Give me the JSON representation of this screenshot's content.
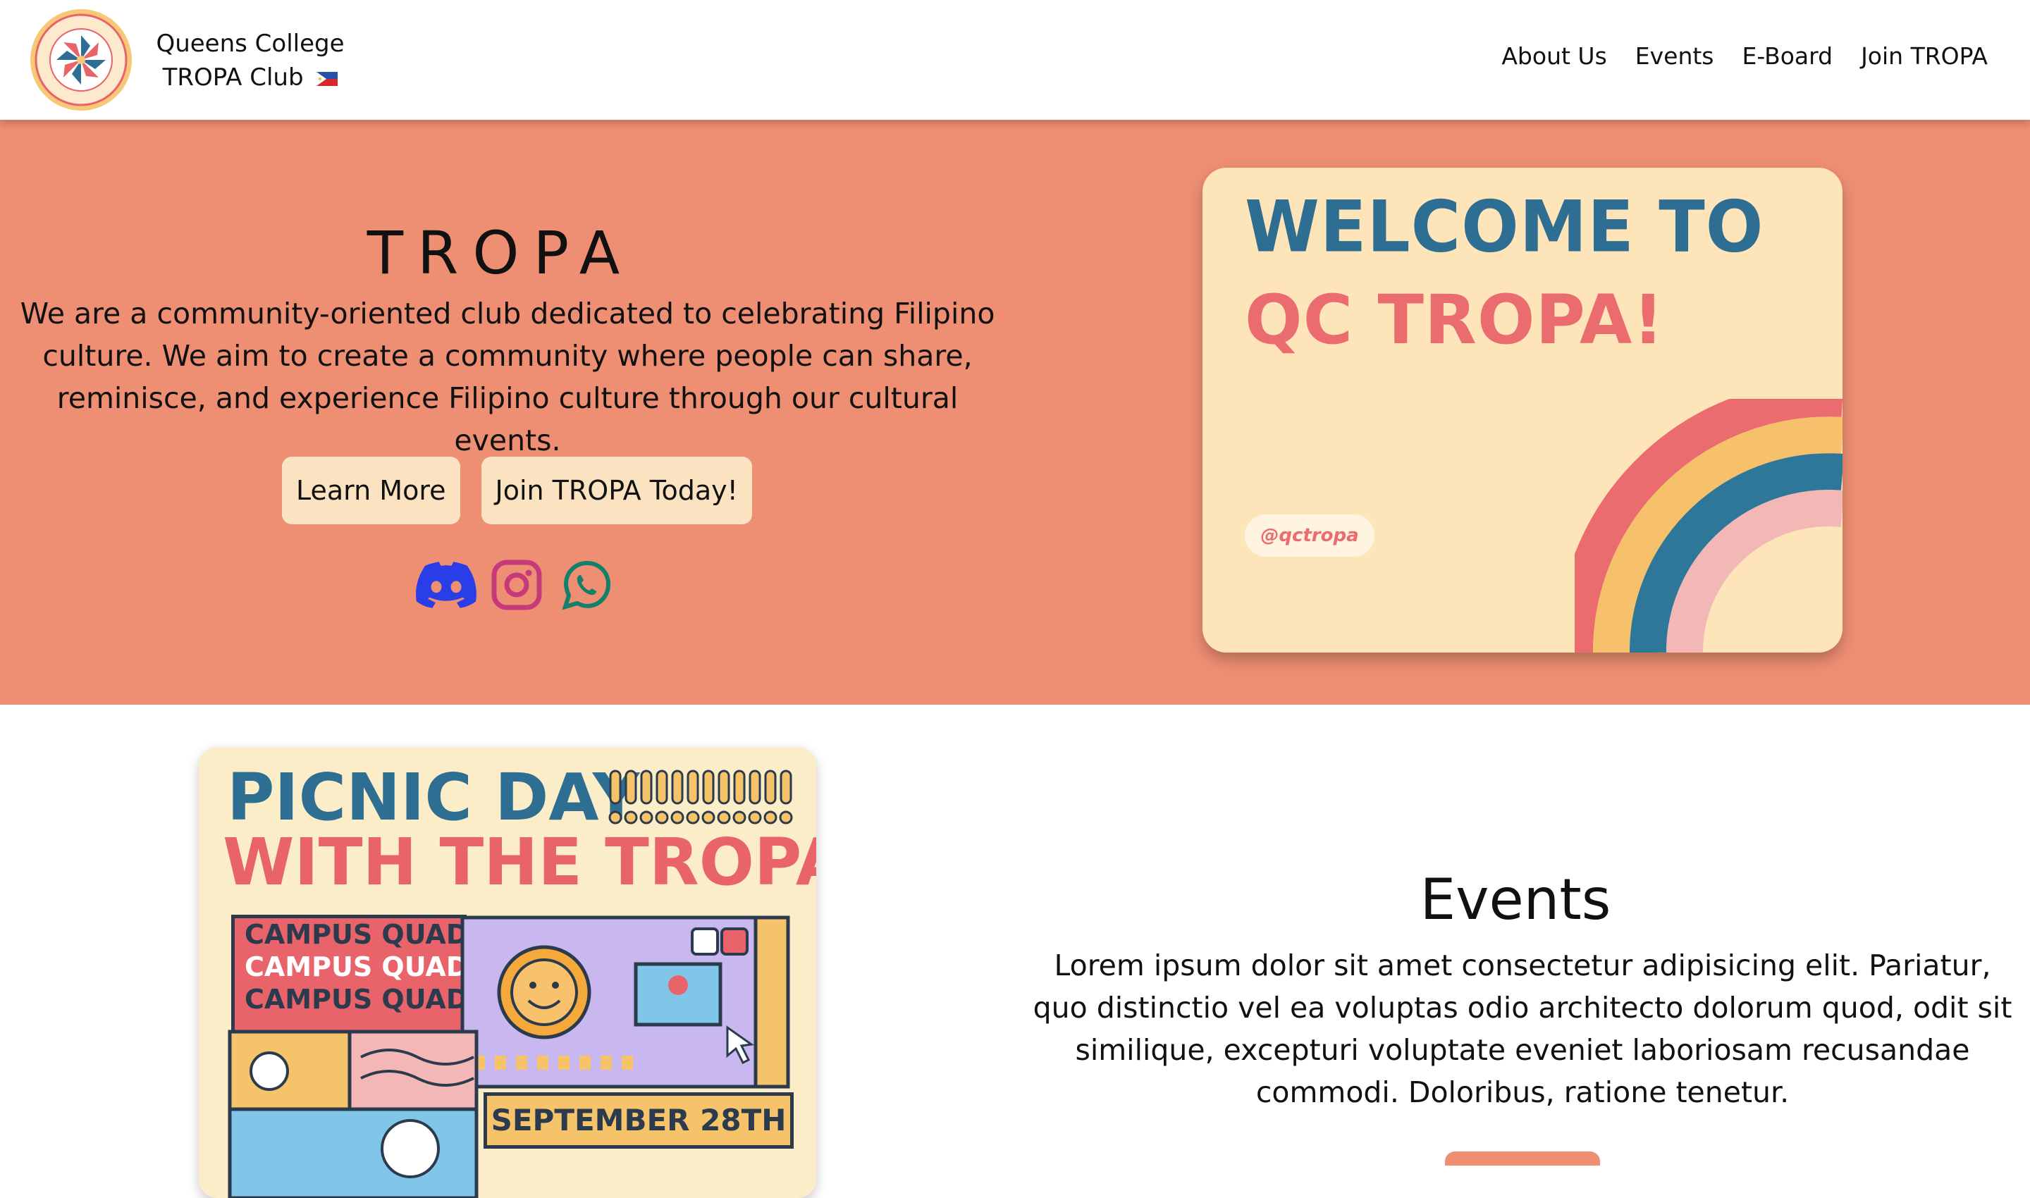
{
  "navbar": {
    "brand_line1": "Queens College",
    "brand_line2": "TROPA Club",
    "links": [
      "About Us",
      "Events",
      "E-Board",
      "Join TROPA"
    ]
  },
  "hero": {
    "title": "TROPA",
    "text": "We are a community-oriented club dedicated to celebrating Filipino culture. We aim to create a community where people can share, reminisce, and experience Filipino culture through our cultural events.",
    "buttons": [
      "Learn More",
      "Join TROPA Today!"
    ],
    "socials": [
      "discord-icon",
      "instagram-icon",
      "whatsapp-icon"
    ],
    "card": {
      "line1": "WELCOME TO",
      "line2": "QC TROPA!",
      "handle": "@qctropa"
    }
  },
  "events": {
    "title": "Events",
    "text": "Lorem ipsum dolor sit amet consectetur adipisicing elit. Pariatur, quo distinctio vel ea voluptas odio architecto dolorum quod, odit sit similique, excepturi voluptate eveniet laboriosam recusandae commodi. Doloribus, ratione tenetur.",
    "poster": {
      "title_line1": "PICNIC DAY",
      "title_line2": "WITH THE TROPAS",
      "quad_lines": [
        "CAMPUS QUAD",
        "CAMPUS QUAD",
        "CAMPUS QUAD"
      ],
      "date": "SEPTEMBER 28TH"
    }
  },
  "colors": {
    "hero_bg": "#ee8f73",
    "button_bg": "#fbe3c1",
    "card_bg": "#fde4b9",
    "accent_blue": "#2e6e93",
    "accent_red": "#ea6c6e"
  }
}
